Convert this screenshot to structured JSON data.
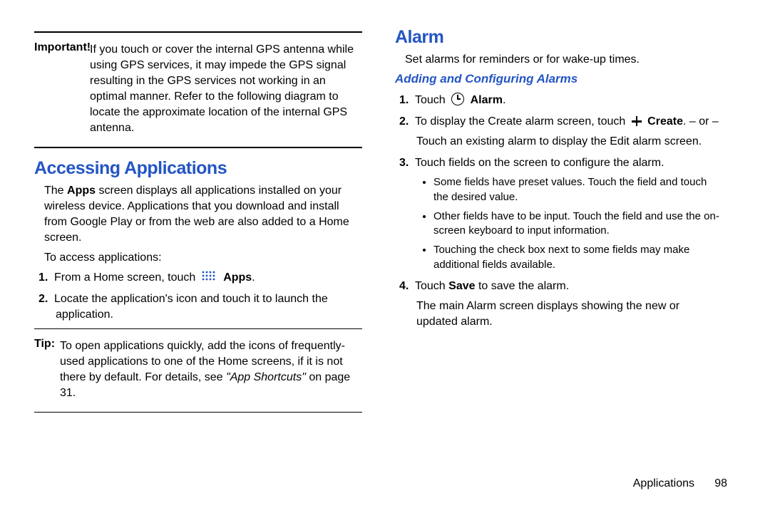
{
  "left": {
    "important_label": "Important!",
    "important_text": "If you touch or cover the internal GPS antenna while using GPS services, it may impede the GPS signal resulting in the GPS services not working in an optimal manner. Refer to the following diagram to locate the approximate location of the internal GPS antenna.",
    "heading": "Accessing Applications",
    "paragraph": "The Apps screen displays all applications installed on your wireless device. Applications that you download and install from Google Play or from the web are also added to a Home screen.",
    "apps_bold": "Apps",
    "lead_in": "To access applications:",
    "step1_pre": "From a Home screen, touch ",
    "step1_bold": "Apps",
    "step1_post": ".",
    "step2": "Locate the application's icon and touch it to launch the application.",
    "tip_label": "Tip:",
    "tip_text_pre": "To open applications quickly, add the icons of frequently-used applications to one of the Home screens, if it is not there by default. For details, see ",
    "tip_text_ital": "\"App Shortcuts\"",
    "tip_text_post": " on page 31."
  },
  "right": {
    "heading": "Alarm",
    "paragraph": "Set alarms for reminders or for wake-up times.",
    "subheading": "Adding and Configuring Alarms",
    "step1_pre": "Touch ",
    "step1_bold": "Alarm",
    "step1_post": ".",
    "step2_pre": "To display the Create alarm screen, touch ",
    "step2_bold": "Create",
    "step2_post": ". – or –",
    "step2_cont": "Touch an existing alarm to display the Edit alarm screen.",
    "step3": "Touch fields on the screen to configure the alarm.",
    "bullets": [
      "Some fields have preset values. Touch the field and touch the desired value.",
      "Other fields have to be input. Touch the field and use the on-screen keyboard to input information.",
      "Touching the check box next to some fields may make additional fields available."
    ],
    "step4_pre": "Touch ",
    "step4_bold": "Save",
    "step4_post": " to save the alarm.",
    "step4_cont": "The main Alarm screen displays showing the new or updated alarm."
  },
  "footer": {
    "chapter": "Applications",
    "page": "98"
  },
  "numbers": {
    "n1": "1.",
    "n2": "2.",
    "n3": "3.",
    "n4": "4."
  }
}
